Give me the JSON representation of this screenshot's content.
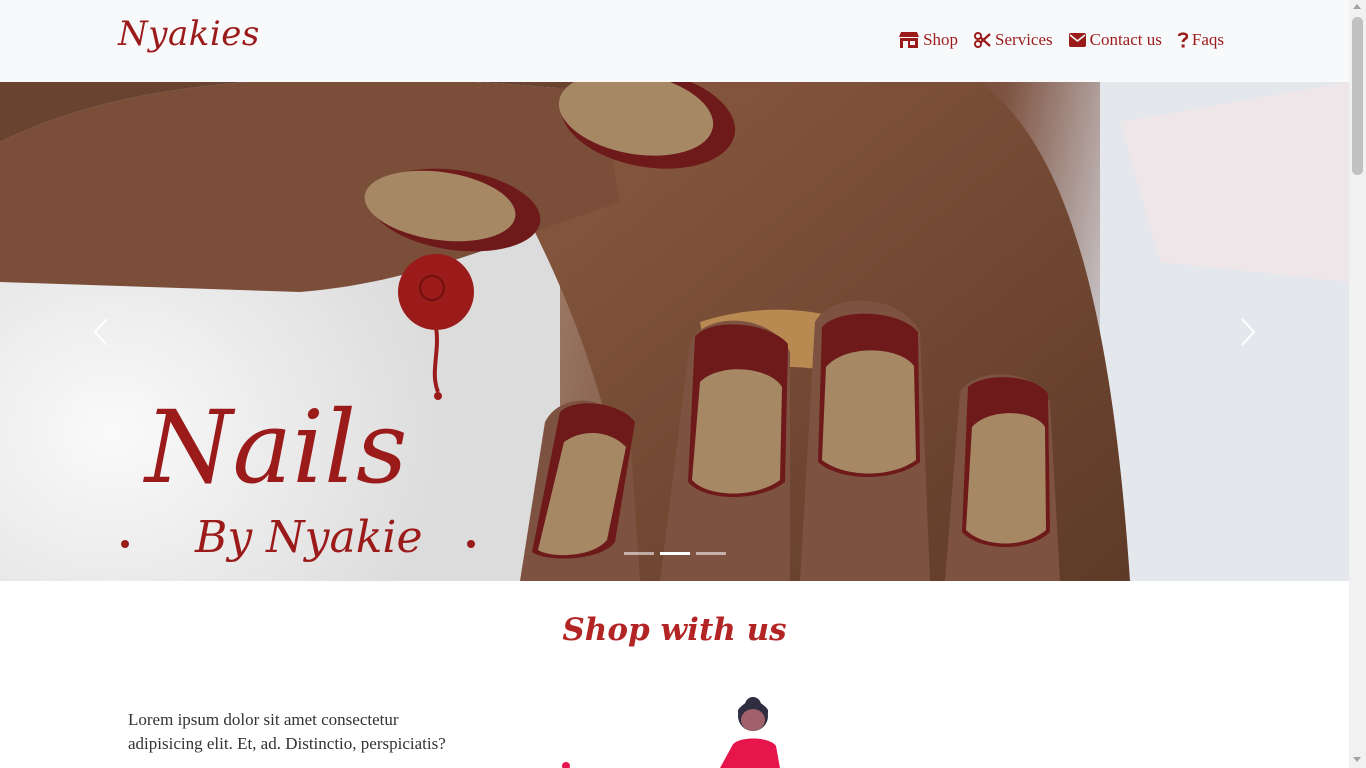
{
  "navbar": {
    "brand": "Nyakies",
    "items": [
      {
        "label": "Shop",
        "icon": "store-icon"
      },
      {
        "label": "Services",
        "icon": "scissors-icon"
      },
      {
        "label": "Contact us",
        "icon": "envelope-icon"
      },
      {
        "label": "Faqs",
        "icon": "question-icon"
      }
    ]
  },
  "carousel": {
    "slide_logo_main": "Nails",
    "slide_logo_sub": "By Nyakie",
    "active_index": 1,
    "indicator_count": 3
  },
  "shop": {
    "heading": "Shop with us",
    "text": "Lorem ipsum dolor sit amet consectetur adipisicing elit. Et, ad. Distinctio, perspiciatis?"
  },
  "colors": {
    "brand": "#9b1b1b",
    "heading": "#b32424",
    "navbar_bg": "#f8f9fa",
    "nail_polish": "#6e1a1a",
    "nail_nude": "#a68865"
  }
}
